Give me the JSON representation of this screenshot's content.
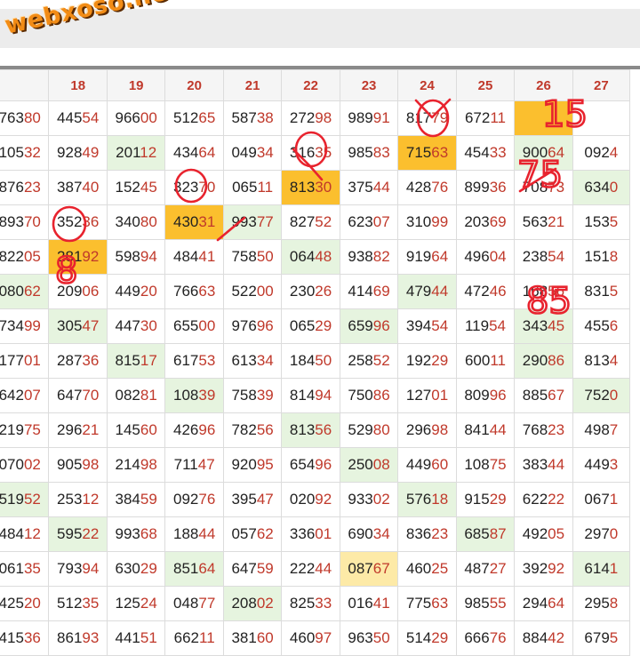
{
  "brand": {
    "watermark": "webxoso.net"
  },
  "columns": [
    "",
    "18",
    "19",
    "20",
    "21",
    "22",
    "23",
    "24",
    "25",
    "26",
    "27"
  ],
  "rows": [
    [
      [
        "763",
        "80"
      ],
      [
        "445",
        "54"
      ],
      [
        "966",
        "00"
      ],
      [
        "512",
        "65"
      ],
      [
        "587",
        "38"
      ],
      [
        "272",
        "98"
      ],
      [
        "989",
        "91"
      ],
      [
        "817",
        "79"
      ],
      [
        "672",
        "11"
      ],
      [
        "",
        ""
      ],
      [
        "",
        ""
      ]
    ],
    [
      [
        "105",
        "32"
      ],
      [
        "928",
        "49"
      ],
      [
        "201",
        "12"
      ],
      [
        "434",
        "64"
      ],
      [
        "049",
        "34"
      ],
      [
        "316",
        "35"
      ],
      [
        "985",
        "83"
      ],
      [
        "715",
        "63"
      ],
      [
        "454",
        "33"
      ],
      [
        "900",
        "64"
      ],
      [
        "092",
        "4"
      ]
    ],
    [
      [
        "876",
        "23"
      ],
      [
        "387",
        "40"
      ],
      [
        "152",
        "45"
      ],
      [
        "323",
        "70"
      ],
      [
        "065",
        "11"
      ],
      [
        "813",
        "30"
      ],
      [
        "375",
        "44"
      ],
      [
        "428",
        "76"
      ],
      [
        "899",
        "36"
      ],
      [
        "708",
        "73"
      ],
      [
        "634",
        "0"
      ]
    ],
    [
      [
        "893",
        "70"
      ],
      [
        "352",
        "36"
      ],
      [
        "340",
        "80"
      ],
      [
        "430",
        "31"
      ],
      [
        "993",
        "77"
      ],
      [
        "827",
        "52"
      ],
      [
        "623",
        "07"
      ],
      [
        "310",
        "99"
      ],
      [
        "203",
        "69"
      ],
      [
        "563",
        "21"
      ],
      [
        "153",
        "5"
      ]
    ],
    [
      [
        "822",
        "05"
      ],
      [
        "281",
        "92"
      ],
      [
        "598",
        "94"
      ],
      [
        "484",
        "41"
      ],
      [
        "758",
        "50"
      ],
      [
        "064",
        "48"
      ],
      [
        "938",
        "82"
      ],
      [
        "919",
        "64"
      ],
      [
        "496",
        "04"
      ],
      [
        "238",
        "54"
      ],
      [
        "151",
        "8"
      ]
    ],
    [
      [
        "080",
        "62"
      ],
      [
        "209",
        "06"
      ],
      [
        "449",
        "20"
      ],
      [
        "766",
        "63"
      ],
      [
        "522",
        "00"
      ],
      [
        "230",
        "26"
      ],
      [
        "414",
        "69"
      ],
      [
        "479",
        "44"
      ],
      [
        "472",
        "46"
      ],
      [
        "168",
        "56"
      ],
      [
        "831",
        "5"
      ]
    ],
    [
      [
        "734",
        "99"
      ],
      [
        "305",
        "47"
      ],
      [
        "447",
        "30"
      ],
      [
        "655",
        "00"
      ],
      [
        "976",
        "96"
      ],
      [
        "065",
        "29"
      ],
      [
        "659",
        "96"
      ],
      [
        "394",
        "54"
      ],
      [
        "119",
        "54"
      ],
      [
        "343",
        "45"
      ],
      [
        "455",
        "6"
      ]
    ],
    [
      [
        "177",
        "01"
      ],
      [
        "287",
        "36"
      ],
      [
        "815",
        "17"
      ],
      [
        "617",
        "53"
      ],
      [
        "613",
        "34"
      ],
      [
        "184",
        "50"
      ],
      [
        "258",
        "52"
      ],
      [
        "192",
        "29"
      ],
      [
        "600",
        "11"
      ],
      [
        "290",
        "86"
      ],
      [
        "813",
        "4"
      ]
    ],
    [
      [
        "642",
        "07"
      ],
      [
        "647",
        "70"
      ],
      [
        "082",
        "81"
      ],
      [
        "108",
        "39"
      ],
      [
        "758",
        "39"
      ],
      [
        "814",
        "94"
      ],
      [
        "750",
        "86"
      ],
      [
        "127",
        "01"
      ],
      [
        "809",
        "96"
      ],
      [
        "885",
        "67"
      ],
      [
        "752",
        "0"
      ]
    ],
    [
      [
        "219",
        "75"
      ],
      [
        "296",
        "21"
      ],
      [
        "145",
        "60"
      ],
      [
        "426",
        "96"
      ],
      [
        "782",
        "56"
      ],
      [
        "813",
        "56"
      ],
      [
        "529",
        "80"
      ],
      [
        "296",
        "98"
      ],
      [
        "841",
        "44"
      ],
      [
        "768",
        "23"
      ],
      [
        "498",
        "7"
      ]
    ],
    [
      [
        "070",
        "02"
      ],
      [
        "905",
        "98"
      ],
      [
        "214",
        "98"
      ],
      [
        "711",
        "47"
      ],
      [
        "920",
        "95"
      ],
      [
        "654",
        "96"
      ],
      [
        "250",
        "08"
      ],
      [
        "449",
        "60"
      ],
      [
        "108",
        "75"
      ],
      [
        "383",
        "44"
      ],
      [
        "449",
        "3"
      ]
    ],
    [
      [
        "519",
        "52"
      ],
      [
        "253",
        "12"
      ],
      [
        "384",
        "59"
      ],
      [
        "092",
        "76"
      ],
      [
        "395",
        "47"
      ],
      [
        "020",
        "92"
      ],
      [
        "933",
        "02"
      ],
      [
        "576",
        "18"
      ],
      [
        "915",
        "29"
      ],
      [
        "622",
        "22"
      ],
      [
        "067",
        "1"
      ]
    ],
    [
      [
        "484",
        "12"
      ],
      [
        "595",
        "22"
      ],
      [
        "993",
        "68"
      ],
      [
        "188",
        "44"
      ],
      [
        "057",
        "62"
      ],
      [
        "336",
        "01"
      ],
      [
        "690",
        "34"
      ],
      [
        "836",
        "23"
      ],
      [
        "685",
        "87"
      ],
      [
        "492",
        "05"
      ],
      [
        "297",
        "0"
      ]
    ],
    [
      [
        "061",
        "35"
      ],
      [
        "793",
        "94"
      ],
      [
        "630",
        "29"
      ],
      [
        "851",
        "64"
      ],
      [
        "647",
        "59"
      ],
      [
        "222",
        "44"
      ],
      [
        "087",
        "67"
      ],
      [
        "460",
        "25"
      ],
      [
        "487",
        "27"
      ],
      [
        "392",
        "92"
      ],
      [
        "614",
        "1"
      ]
    ],
    [
      [
        "425",
        "20"
      ],
      [
        "512",
        "35"
      ],
      [
        "125",
        "24"
      ],
      [
        "048",
        "77"
      ],
      [
        "208",
        "02"
      ],
      [
        "825",
        "33"
      ],
      [
        "016",
        "41"
      ],
      [
        "775",
        "63"
      ],
      [
        "985",
        "55"
      ],
      [
        "294",
        "64"
      ],
      [
        "295",
        "8"
      ]
    ],
    [
      [
        "415",
        "36"
      ],
      [
        "861",
        "93"
      ],
      [
        "441",
        "51"
      ],
      [
        "662",
        "11"
      ],
      [
        "381",
        "60"
      ],
      [
        "460",
        "97"
      ],
      [
        "963",
        "50"
      ],
      [
        "514",
        "29"
      ],
      [
        "666",
        "76"
      ],
      [
        "884",
        "42"
      ],
      [
        "679",
        "5"
      ]
    ]
  ],
  "highlights": {
    "orange": [
      "0-9",
      "1-7",
      "2-5",
      "3-3",
      "4-1"
    ],
    "yellow": [
      "13-6"
    ],
    "green": [
      "1-2",
      "1-9",
      "2-10",
      "3-4",
      "4-5",
      "5-0",
      "5-7",
      "6-1",
      "6-6",
      "6-9",
      "7-2",
      "7-9",
      "8-3",
      "8-10",
      "9-5",
      "10-6",
      "11-0",
      "11-7",
      "12-1",
      "12-8",
      "13-3",
      "13-10",
      "14-4"
    ]
  },
  "annotations": [
    "15",
    "75",
    "85",
    "8"
  ],
  "colors": {
    "accent_red": "#c0392b",
    "highlight_orange": "#fbbf2e",
    "highlight_green": "#e6f4df",
    "highlight_yellow": "#fdeaa7",
    "ink_red": "#e8232e"
  }
}
